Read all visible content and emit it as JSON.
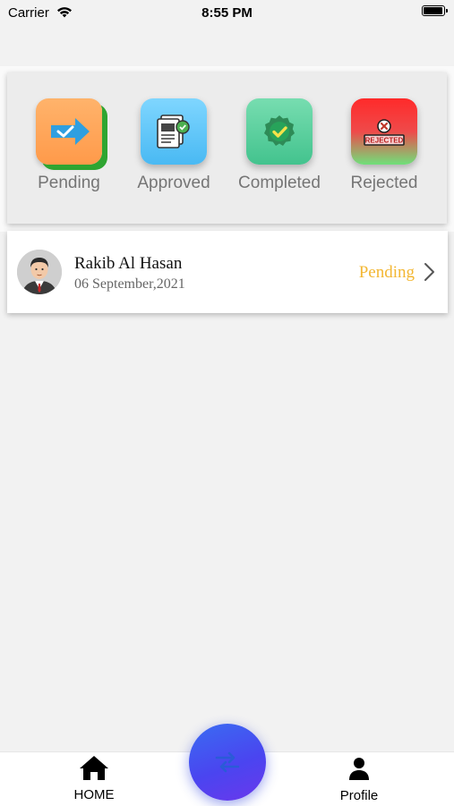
{
  "status_bar": {
    "carrier": "Carrier",
    "time": "8:55 PM"
  },
  "categories": [
    {
      "label": "Pending",
      "icon": "arrow-check-icon"
    },
    {
      "label": "Approved",
      "icon": "document-approved-icon"
    },
    {
      "label": "Completed",
      "icon": "badge-check-icon"
    },
    {
      "label": "Rejected",
      "icon": "rejected-stamp-icon",
      "stamp_text": "REJECTED"
    }
  ],
  "requests": [
    {
      "name": "Rakib Al Hasan",
      "date": "06 September,2021",
      "status": "Pending",
      "status_color": "#f3b733"
    }
  ],
  "bottom_nav": {
    "home_label": "HOME",
    "profile_label": "Profile"
  },
  "colors": {
    "fab_start": "#3a6cf2",
    "fab_end": "#6a38ec",
    "pending": "#f3b733"
  }
}
